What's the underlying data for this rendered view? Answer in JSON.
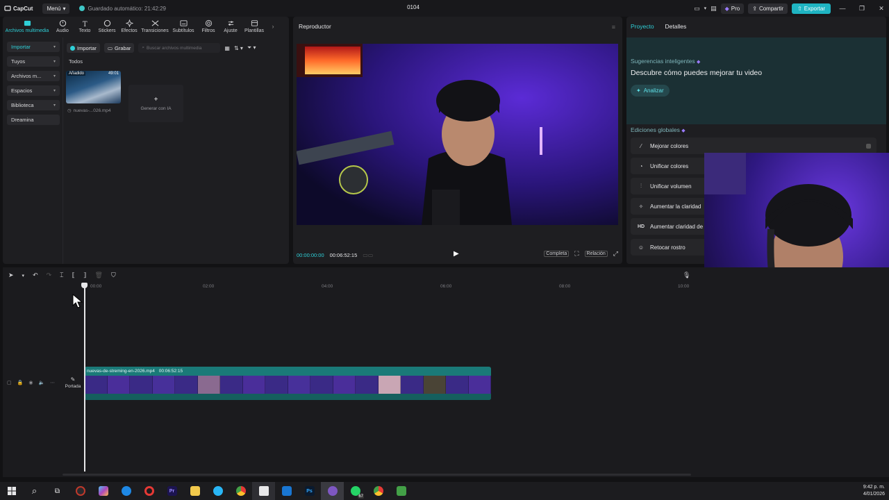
{
  "titlebar": {
    "logo": "CapCut",
    "menu": "Menú",
    "autosave": "Guardado automático: 21:42:29",
    "project_name": "0104",
    "pro": "Pro",
    "share": "Compartir",
    "export": "Exportar"
  },
  "tools": [
    {
      "label": "Archivos multimedia",
      "icon": "media-icon"
    },
    {
      "label": "Audio",
      "icon": "audio-icon"
    },
    {
      "label": "Texto",
      "icon": "text-icon"
    },
    {
      "label": "Stickers",
      "icon": "sticker-icon"
    },
    {
      "label": "Efectos",
      "icon": "effects-icon"
    },
    {
      "label": "Transiciones",
      "icon": "transition-icon"
    },
    {
      "label": "Subtítulos",
      "icon": "subtitles-icon"
    },
    {
      "label": "Filtros",
      "icon": "filters-icon"
    },
    {
      "label": "Ajuste",
      "icon": "adjust-icon"
    },
    {
      "label": "Plantillas",
      "icon": "templates-icon"
    }
  ],
  "nav": [
    "Importar",
    "Tuyos",
    "Archivos m...",
    "Espacios",
    "Biblioteca",
    "Dreamina"
  ],
  "media": {
    "import": "Importar",
    "record": "Grabar",
    "search_placeholder": "Buscar archivos multimedia",
    "section": "Todos",
    "clip_badge": "Añadido",
    "clip_duration": "49:01",
    "clip_name": "nuevas-...026.mp4",
    "generate": "Generar con IA"
  },
  "player": {
    "title": "Reproductor",
    "current_time": "00:00:00:00",
    "total_time": "00:06:52:15",
    "full": "Completa",
    "ratio": "Relación"
  },
  "right": {
    "tab_project": "Proyecto",
    "tab_details": "Detalles",
    "suggest_title": "Sugerencias inteligentes",
    "suggest_head": "Descubre cómo puedes mejorar tu video",
    "analyze": "Analizar",
    "global_title": "Ediciones globales",
    "edits": [
      {
        "icon": "wand-icon",
        "label": "Mejorar colores"
      },
      {
        "icon": "palette-icon",
        "label": "Unificar colores"
      },
      {
        "icon": "sliders-icon",
        "label": "Unificar volumen"
      },
      {
        "icon": "sparkle-icon",
        "label": "Aumentar la claridad"
      },
      {
        "icon": "hd-icon",
        "label": "Aumentar claridad de"
      },
      {
        "icon": "face-icon",
        "label": "Retocar rostro"
      }
    ]
  },
  "timeline": {
    "ticks": [
      "00:00",
      "02:00",
      "04:00",
      "06:00",
      "08:00",
      "10:00"
    ],
    "clip_name": "nuevas-de-streming-en-2026.mp4",
    "clip_duration": "00:06:52:15",
    "cover": "Portada"
  },
  "taskbar": {
    "time": "9:42 p. m.",
    "date": "4/01/2026",
    "whatsapp_badge": "67"
  },
  "colors": {
    "accent": "#2fd0d8",
    "export": "#1fb4c2",
    "clip": "#1a7a78"
  }
}
